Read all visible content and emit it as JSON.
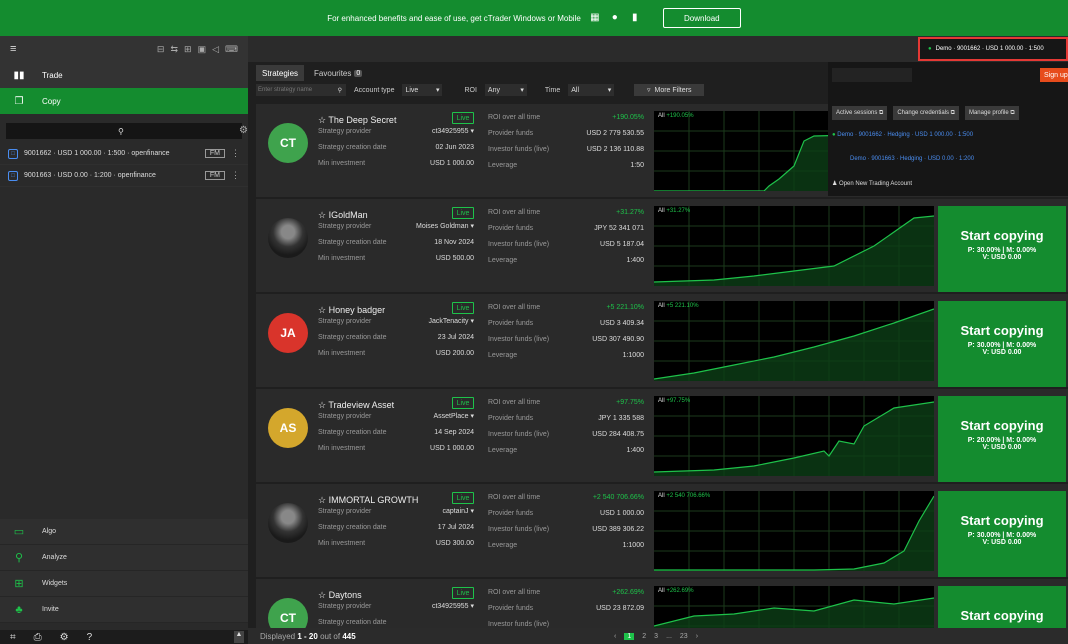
{
  "banner": {
    "text": "For enhanced benefits and ease of use, get cTrader Windows or Mobile",
    "download": "Download",
    "icons": [
      "windows-icon",
      "apple-icon",
      "android-icon"
    ]
  },
  "sidebar": {
    "nav": [
      {
        "label": "Trade",
        "icon": "bars-icon"
      },
      {
        "label": "Copy",
        "icon": "copy-icon"
      }
    ],
    "accounts": [
      {
        "text": "9001662 · USD 1 000.00 · 1:500 · openfinance",
        "tag": "FM"
      },
      {
        "text": "9001663 · USD 0.00 · 1:200 · openfinance",
        "tag": "FM"
      }
    ],
    "bottom_nav": [
      {
        "label": "Algo",
        "icon": "algo-icon"
      },
      {
        "label": "Analyze",
        "icon": "analyze-icon"
      },
      {
        "label": "Widgets",
        "icon": "widgets-icon"
      },
      {
        "label": "Invite",
        "icon": "invite-icon"
      }
    ]
  },
  "header": {
    "account": "Demo · 9001662 · USD 1 000.00 · 1:500",
    "signup": "Sign up"
  },
  "account_panel": {
    "buttons": [
      "Active sessions ⧉",
      "Change credentials ⧉",
      "Manage profile ⧉"
    ],
    "line1": "Demo · 9001662 · Hedging · USD 1 000.00 · 1:500",
    "line2": "Demo · 9001663 · Hedging · USD 0.00 · 1:200",
    "open": "Open New Trading Account"
  },
  "tabs": {
    "strategies": "Strategies",
    "favourites": "Favourites",
    "fav_count": "0"
  },
  "filters": {
    "search_placeholder": "Enter strategy name",
    "account_type_label": "Account type",
    "account_type": "Live",
    "roi_label": "ROI",
    "roi": "Any",
    "time_label": "Time",
    "time": "All",
    "more": "More Filters"
  },
  "labels": {
    "provider": "Strategy provider",
    "created": "Strategy creation date",
    "min": "Min investment",
    "roi": "ROI over all time",
    "pfunds": "Provider funds",
    "ifunds": "Investor funds (live)",
    "leverage": "Leverage",
    "live": "Live",
    "all": "All",
    "start": "Start copying"
  },
  "strategies": [
    {
      "name": "The Deep Secret",
      "initials": "CT",
      "color": "#3fa34d",
      "provider": "ct34925955",
      "created": "02 Jun 2023",
      "min": "USD 1 000.00",
      "roi": "+190.05%",
      "pfunds": "USD 2 779 530.55",
      "ifunds": "USD 2 136 110.88",
      "leverage": "1:50",
      "chart_roi": "+190.05%",
      "stats": "",
      "stats2": ""
    },
    {
      "name": "IGoldMan",
      "initials": "",
      "color": "",
      "provider": "Moises Goldman",
      "created": "18 Nov 2024",
      "min": "USD 500.00",
      "roi": "+31.27%",
      "pfunds": "JPY 52 341 071",
      "ifunds": "USD 5 187.04",
      "leverage": "1:400",
      "chart_roi": "+31.27%",
      "stats": "P: 30.00% | M: 0.00%",
      "stats2": "V: USD 0.00"
    },
    {
      "name": "Honey badger",
      "initials": "JA",
      "color": "#d9342b",
      "provider": "JackTenacity",
      "created": "23 Jul 2024",
      "min": "USD 200.00",
      "roi": "+5 221.10%",
      "pfunds": "USD 3 409.34",
      "ifunds": "USD 307 490.90",
      "leverage": "1:1000",
      "chart_roi": "+5 221.10%",
      "stats": "P: 30.00% | M: 0.00%",
      "stats2": "V: USD 0.00"
    },
    {
      "name": "Tradeview Asset",
      "initials": "AS",
      "color": "#d4a72c",
      "provider": "AssetPlace",
      "created": "14 Sep 2024",
      "min": "USD 1 000.00",
      "roi": "+97.75%",
      "pfunds": "JPY 1 335 588",
      "ifunds": "USD 284 408.75",
      "leverage": "1:400",
      "chart_roi": "+97.75%",
      "stats": "P: 20.00% | M: 0.00%",
      "stats2": "V: USD 0.00"
    },
    {
      "name": "IMMORTAL GROWTH",
      "initials": "",
      "color": "",
      "provider": "captainJ",
      "created": "17 Jul 2024",
      "min": "USD 300.00",
      "roi": "+2 540 706.66%",
      "pfunds": "USD 1 000.00",
      "ifunds": "USD 389 306.22",
      "leverage": "1:1000",
      "chart_roi": "+2 540 706.66%",
      "stats": "P: 30.00% | M: 0.00%",
      "stats2": "V: USD 0.00"
    },
    {
      "name": "Daytons",
      "initials": "CT",
      "color": "#3fa34d",
      "provider": "ct34925955",
      "created": "",
      "min": "",
      "roi": "+262.69%",
      "pfunds": "USD 23 872.09",
      "ifunds": "",
      "leverage": "",
      "chart_roi": "+262.69%",
      "stats": "",
      "stats2": ""
    }
  ],
  "footer": {
    "displayed": "Displayed",
    "range": "1 - 20",
    "out_of": "out of",
    "total": "445",
    "pages": [
      "1",
      "2",
      "3",
      "...",
      "23"
    ]
  }
}
